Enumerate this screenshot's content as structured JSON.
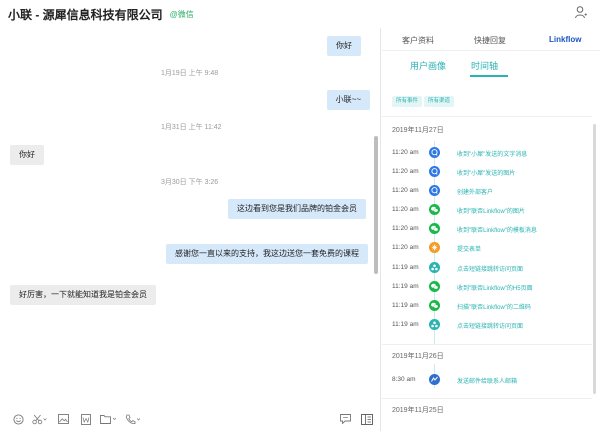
{
  "header": {
    "title": "小联 - 源犀信息科技有限公司",
    "channel": "@微信"
  },
  "chat": {
    "messages": [
      {
        "dir": "out",
        "text": "你好"
      },
      {
        "dir": "out",
        "text": "小联~~"
      },
      {
        "dir": "in",
        "text": "你好"
      },
      {
        "dir": "out",
        "text": "这边看到您是我们品牌的铂金会员"
      },
      {
        "dir": "out",
        "text": "感谢您一直以来的支持，我这边送您一套免费的课程"
      },
      {
        "dir": "in",
        "text": "好厉害，一下就能知道我是铂金会员"
      }
    ],
    "timestamps": [
      "1月19日 上午 9:48",
      "1月31日 上午 11:42",
      "3月30日 下午 3:26"
    ]
  },
  "toolbar": {
    "icons": [
      "emoji-icon",
      "scissors-icon",
      "image-icon",
      "word-doc-icon",
      "folder-icon",
      "phone-icon",
      "quick-reply-icon",
      "side-panel-icon"
    ]
  },
  "panel": {
    "tabs": [
      "客户资料",
      "快捷回复",
      "Linkflow"
    ],
    "subtabs": [
      "用户画像",
      "时间轴"
    ],
    "filters": [
      "所有事件",
      "所有渠道"
    ],
    "groups": [
      {
        "date": "2019年11月27日",
        "events": [
          {
            "time": "11:20 am",
            "text": "收到\"小犀\"发送的文字消息",
            "icon": "chat-bubble-icon",
            "color": "#2f78e6"
          },
          {
            "time": "11:20 am",
            "text": "收到\"小犀\"发送的图片",
            "icon": "chat-bubble-icon",
            "color": "#2f78e6"
          },
          {
            "time": "11:20 am",
            "text": "创建外部客户",
            "icon": "chat-bubble-icon",
            "color": "#2f78e6"
          },
          {
            "time": "11:20 am",
            "text": "收到\"联否Linkflow\"的图片",
            "icon": "wechat-icon",
            "color": "#19b84a"
          },
          {
            "time": "11:20 am",
            "text": "收到\"联否Linkflow\"的模板消息",
            "icon": "wechat-icon",
            "color": "#19b84a"
          },
          {
            "time": "11:20 am",
            "text": "提交表单",
            "icon": "form-icon",
            "color": "#f59a23"
          },
          {
            "time": "11:19 am",
            "text": "点击短链接跳转访问页面",
            "icon": "link-icon",
            "color": "#2bb3b3"
          },
          {
            "time": "11:19 am",
            "text": "收到\"联否Linkflow\"的H5页面",
            "icon": "wechat-icon",
            "color": "#19b84a"
          },
          {
            "time": "11:19 am",
            "text": "扫描\"联否Linkflow\"的二维码",
            "icon": "wechat-icon",
            "color": "#19b84a"
          },
          {
            "time": "11:19 am",
            "text": "点击短链接跳转访问页面",
            "icon": "link-icon",
            "color": "#2bb3b3"
          }
        ]
      },
      {
        "date": "2019年11月26日",
        "events": [
          {
            "time": "8:30 am",
            "text": "发送邮件给联系人邮箱",
            "icon": "mail-icon",
            "color": "#2f6fcf"
          }
        ]
      },
      {
        "date": "2019年11月25日",
        "events": []
      }
    ]
  }
}
